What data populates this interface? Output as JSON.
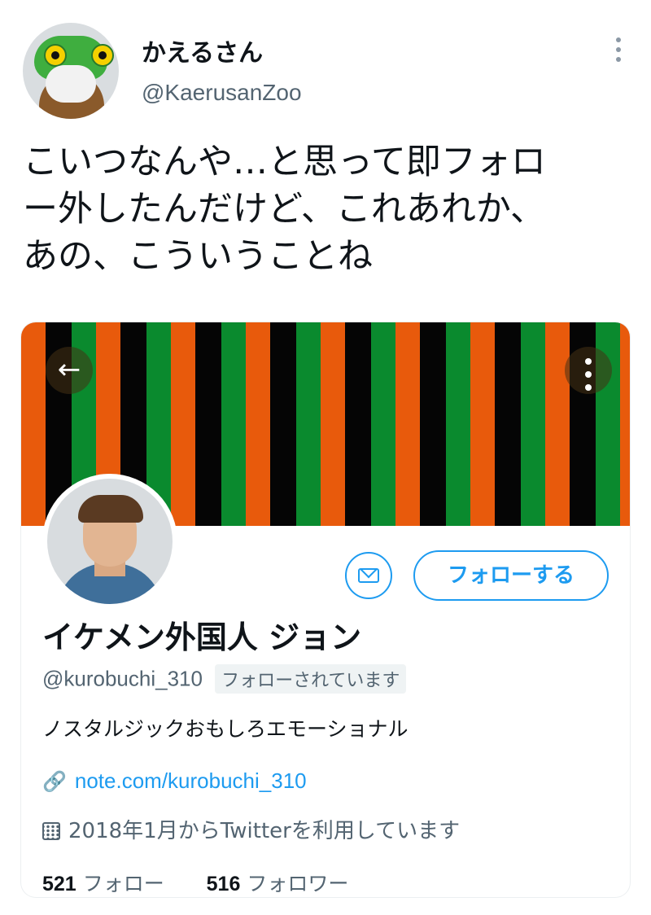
{
  "tweet": {
    "author_name": "かえるさん",
    "author_handle": "@KaerusanZoo",
    "text_line1": "こいつなんや…と思って即フォロ",
    "text_line2": "ー外したんだけど、これあれか、",
    "text_line3": "あの、こういうことね"
  },
  "embedded_profile": {
    "back_icon": "←",
    "name": "イケメン外国人 ジョン",
    "handle": "@kurobuchi_310",
    "follows_you_badge": "フォローされています",
    "follow_button_label": "フォローする",
    "bio": "ノスタルジックおもしろエモーショナル",
    "link_text": "note.com/kurobuchi_310",
    "link_icon": "🔗",
    "joined_text": "2018年1月からTwitterを利用しています",
    "following_count": "521",
    "following_label": "フォロー",
    "followers_count": "516",
    "followers_label": "フォロワー"
  },
  "colors": {
    "accent": "#1d9bf0",
    "banner_orange": "#e85a0c",
    "banner_black": "#050505",
    "banner_green": "#0a8a2e"
  }
}
